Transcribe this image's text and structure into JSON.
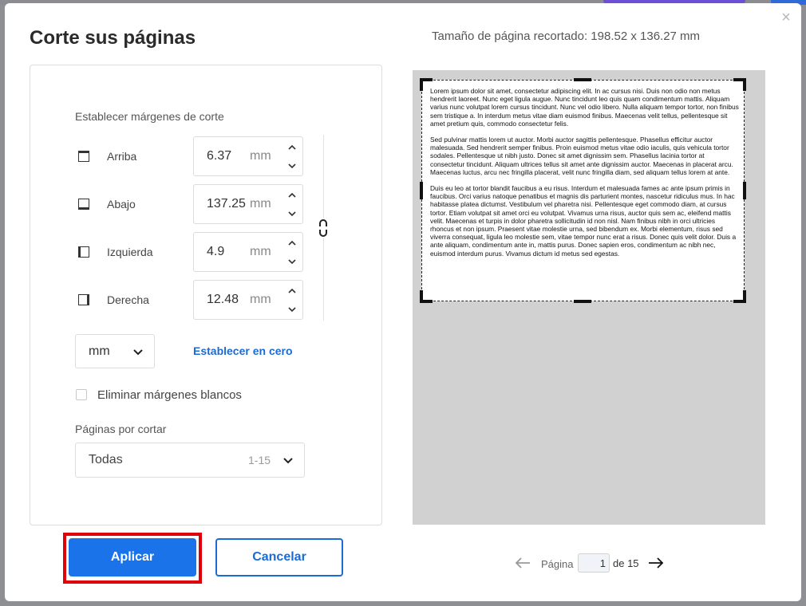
{
  "modal": {
    "title": "Corte sus páginas",
    "page_size_info": "Tamaño de página recortado: 198.52 x 136.27 mm",
    "close_glyph": "×"
  },
  "margins": {
    "section_label": "Establecer márgenes de corte",
    "rows": [
      {
        "label": "Arriba",
        "value": "6.37",
        "unit": "mm",
        "icon": "margin-top-icon"
      },
      {
        "label": "Abajo",
        "value": "137.25",
        "unit": "mm",
        "icon": "margin-bottom-icon"
      },
      {
        "label": "Izquierda",
        "value": "4.9",
        "unit": "mm",
        "icon": "margin-left-icon"
      },
      {
        "label": "Derecha",
        "value": "12.48",
        "unit": "mm",
        "icon": "margin-right-icon"
      }
    ],
    "unit_select": "mm",
    "set_zero_link": "Establecer en cero"
  },
  "options": {
    "remove_white_margins": "Eliminar márgenes blancos",
    "remove_white_margins_checked": false
  },
  "pages": {
    "label": "Páginas por cortar",
    "selected": "Todas",
    "range": "1-15"
  },
  "buttons": {
    "apply": "Aplicar",
    "cancel": "Cancelar"
  },
  "preview": {
    "paragraphs": [
      "Lorem ipsum dolor sit amet, consectetur adipiscing elit. In ac cursus nisi. Duis non odio non metus hendrerit laoreet. Nunc eget ligula augue. Nunc tincidunt leo quis quam condimentum mattis. Aliquam varius nunc volutpat lorem cursus tincidunt. Nunc vel odio libero. Nulla aliquam tempor tortor, non finibus sem tristique a. In interdum metus vitae diam euismod finibus. Maecenas velit tellus, pellentesque sit amet pretium quis, commodo consectetur felis.",
      "Sed pulvinar mattis lorem ut auctor. Morbi auctor sagittis pellentesque. Phasellus efficitur auctor malesuada. Sed hendrerit semper finibus. Proin euismod metus vitae odio iaculis, quis vehicula tortor sodales. Pellentesque ut nibh justo. Donec sit amet dignissim sem. Phasellus lacinia tortor at consectetur tincidunt. Aliquam ultrices tellus sit amet ante dignissim auctor. Maecenas in placerat arcu. Maecenas luctus, arcu nec fringilla placerat, velit nunc fringilla diam, sed aliquam tellus lorem at ante.",
      "Duis eu leo at tortor blandit faucibus a eu risus. Interdum et malesuada fames ac ante ipsum primis in faucibus. Orci varius natoque penatibus et magnis dis parturient montes, nascetur ridiculus mus. In hac habitasse platea dictumst. Vestibulum vel pharetra nisi. Pellentesque eget commodo diam, at cursus tortor. Etiam volutpat sit amet orci eu volutpat. Vivamus urna risus, auctor quis sem ac, eleifend mattis velit. Maecenas et turpis in dolor pharetra sollicitudin id non nisl. Nam finibus nibh in orci ultricies rhoncus et non ipsum. Praesent vitae molestie urna, sed bibendum ex. Morbi elementum, risus sed viverra consequat, ligula leo molestie sem, vitae tempor nunc erat a risus. Donec quis velit dolor. Duis a ante aliquam, condimentum ante in, mattis purus. Donec sapien eros, condimentum ac nibh nec, euismod interdum purus. Vivamus dictum id metus sed egestas."
    ]
  },
  "pagination": {
    "page_word": "Página",
    "current": "1",
    "of_total": "de 15"
  },
  "colors": {
    "accent": "#1a73e8",
    "highlight": "#e0000a",
    "preview_bg": "#d1d1d1"
  }
}
